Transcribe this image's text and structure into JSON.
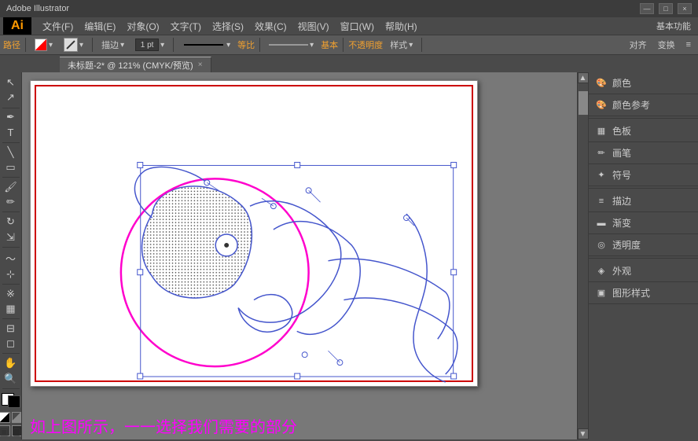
{
  "app": {
    "logo": "Ai",
    "title": "Adobe Illustrator",
    "window_title": "未标题-2* @ 121% (CMYK/预览)"
  },
  "menubar": {
    "items": [
      "文件(F)",
      "编辑(E)",
      "对象(O)",
      "文字(T)",
      "选择(S)",
      "效果(C)",
      "视图(V)",
      "窗口(W)",
      "帮助(H)"
    ]
  },
  "toolbar": {
    "path_label": "路径",
    "miaobiao": "描边",
    "stroke_width": "1 pt",
    "dengbi": "等比",
    "jiben": "基本",
    "butongmingdu": "不透明度",
    "yangshi": "样式",
    "duiqi": "对齐",
    "bianhuan": "变换",
    "jiben_func": "基本功能"
  },
  "tab": {
    "label": "未标题-2* @ 121% (CMYK/预览)",
    "close": "×"
  },
  "right_panel": {
    "items": [
      {
        "icon": "🎨",
        "label": "颜色"
      },
      {
        "icon": "🎨",
        "label": "颜色参考"
      },
      {
        "icon": "▦",
        "label": "色板"
      },
      {
        "icon": "✏️",
        "label": "画笔"
      },
      {
        "icon": "✦",
        "label": "符号"
      },
      {
        "icon": "—",
        "label": "描边"
      },
      {
        "icon": "▬",
        "label": "渐变"
      },
      {
        "icon": "◎",
        "label": "透明度"
      },
      {
        "icon": "◈",
        "label": "外观"
      },
      {
        "icon": "▣",
        "label": "图形样式"
      }
    ]
  },
  "caption": {
    "text": "如上图所示，一一选择我们需要的部分"
  },
  "win_controls": {
    "minimize": "—",
    "maximize": "□",
    "close": "×"
  },
  "tools": [
    "↗",
    "↘",
    "✏",
    "⌁",
    "T",
    "◯",
    "☐",
    "✂",
    "✋",
    "⊕",
    "⌀",
    "⬡",
    "▦",
    "∿",
    "⊞",
    "▣",
    "🔍"
  ]
}
